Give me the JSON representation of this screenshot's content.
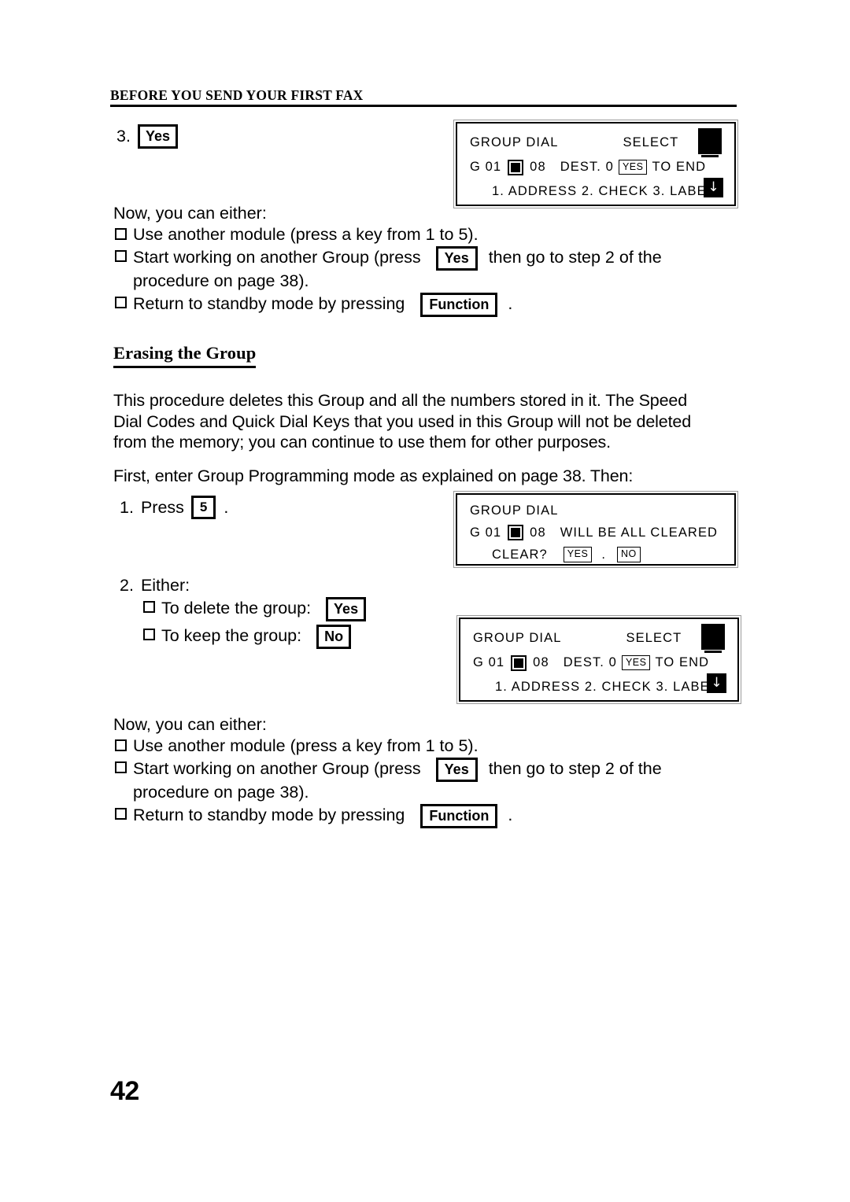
{
  "header": {
    "running_title": "BEFORE YOU SEND YOUR FIRST FAX"
  },
  "step3": {
    "number": "3.",
    "key": "Yes"
  },
  "lcd1": {
    "line1_left": "GROUP DIAL",
    "line1_right": "SELECT",
    "line2_a": "G 01",
    "line2_b": "08",
    "line2_c": "DEST. 0",
    "line2_key": "YES",
    "line2_d": "TO END",
    "line3": "1. ADDRESS 2. CHECK 3. LABEL",
    "arrow_icon": "↓"
  },
  "choices_top": {
    "intro": "Now, you can either:",
    "item1": "Use another module (press a key from 1 to 5).",
    "item2_pre": "Start working on another Group (press",
    "item2_key": "Yes",
    "item2_post": "then go to step 2 of the",
    "item2_cont": "procedure on page  38).",
    "item3_pre": "Return to standby mode by pressing",
    "item3_key": "Function",
    "item3_post": "."
  },
  "section": {
    "heading": "Erasing the Group",
    "para1": "This procedure deletes this Group and all the numbers stored in it. The Speed Dial Codes and Quick Dial Keys that you used in this Group will not be deleted from the memory; you can continue to use them for other purposes.",
    "para2": "First, enter Group Programming mode as explained on page  38. Then:"
  },
  "step1": {
    "number": "1.",
    "label": "Press",
    "key": "5",
    "period": "."
  },
  "lcd2": {
    "line1": "GROUP DIAL",
    "line2_a": "G 01",
    "line2_b": "08",
    "line2_c": "WILL BE ALL CLEARED",
    "line3_label": "CLEAR?",
    "line3_key_yes": "YES",
    "line3_dot": ".",
    "line3_key_no": "NO"
  },
  "step2": {
    "number": "2.",
    "label": "Either:",
    "item1_text": "To delete the group:",
    "item1_key": "Yes",
    "item2_text": "To keep the group:",
    "item2_key": "No"
  },
  "lcd3": {
    "line1_left": "GROUP DIAL",
    "line1_right": "SELECT",
    "line2_a": "G 01",
    "line2_b": "08",
    "line2_c": "DEST. 0",
    "line2_key": "YES",
    "line2_d": "TO END",
    "line3": "1. ADDRESS 2. CHECK 3. LABEL",
    "arrow_icon": "↓"
  },
  "choices_bottom": {
    "intro": "Now, you can either:",
    "item1": "Use another module (press a key from 1 to 5).",
    "item2_pre": "Start working on another Group (press",
    "item2_key": "Yes",
    "item2_post": "then go to step 2 of the",
    "item2_cont": "procedure on page  38).",
    "item3_pre": "Return to standby mode by pressing",
    "item3_key": "Function",
    "item3_post": "."
  },
  "folio": {
    "page_number": "42"
  }
}
